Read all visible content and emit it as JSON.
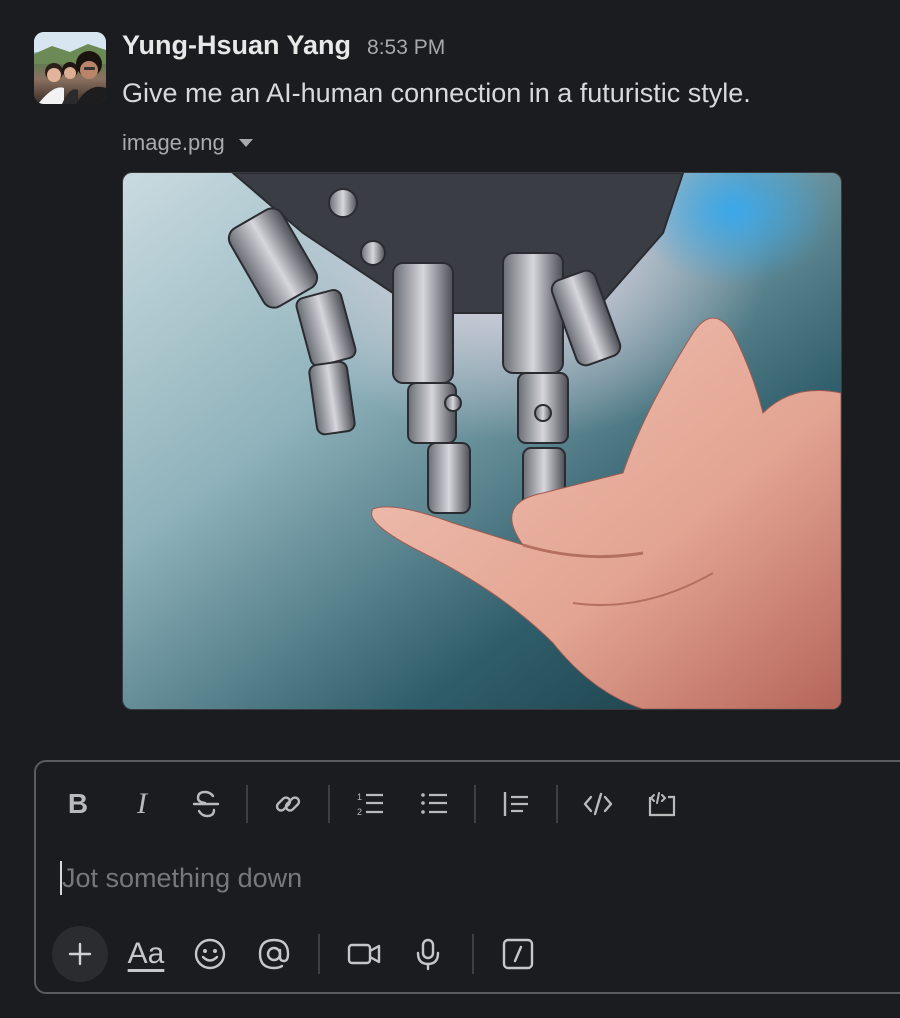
{
  "message": {
    "author": "Yung-Hsuan Yang",
    "timestamp": "8:53 PM",
    "text": "Give me an AI-human connection in a futuristic style.",
    "attachment": {
      "filename": "image.png"
    }
  },
  "composer": {
    "placeholder": "Jot something down",
    "text_style_label": "Aa",
    "toolbar": [
      "bold-icon",
      "italic-icon",
      "strikethrough-icon",
      "link-icon",
      "ordered-list-icon",
      "bulleted-list-icon",
      "blockquote-icon",
      "code-icon",
      "code-block-icon"
    ],
    "bottom_actions": [
      "plus-icon",
      "text-formatting-icon",
      "emoji-icon",
      "mention-icon",
      "video-icon",
      "microphone-icon",
      "slash-command-icon"
    ]
  },
  "colors": {
    "background": "#1b1c1f",
    "text": "#d1d2d3",
    "muted": "#a7a8aa",
    "border": "#5b5c5f"
  }
}
